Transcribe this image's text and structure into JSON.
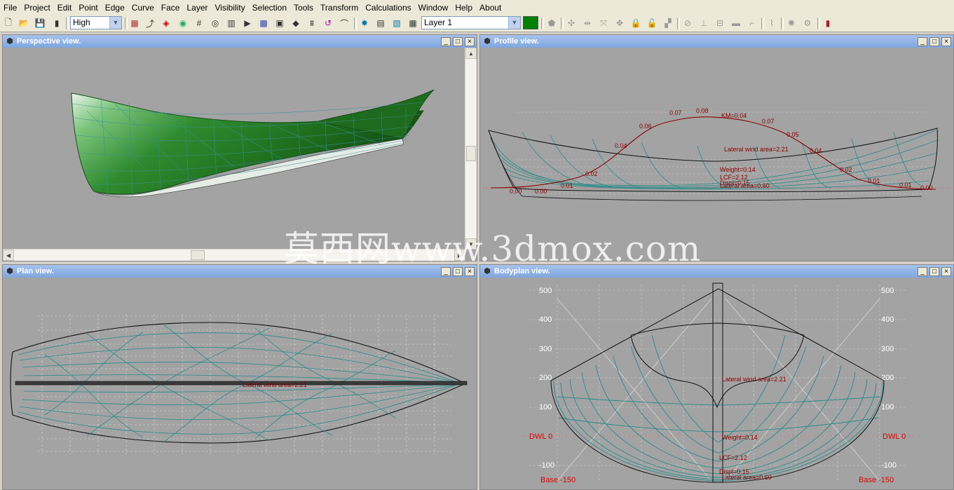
{
  "menu": [
    "File",
    "Project",
    "Edit",
    "Point",
    "Edge",
    "Curve",
    "Face",
    "Layer",
    "Visibility",
    "Selection",
    "Tools",
    "Transform",
    "Calculations",
    "Window",
    "Help",
    "About"
  ],
  "toolbar": {
    "precision_value": "High",
    "layer_value": "Layer 1",
    "layer_color": "#008000"
  },
  "windows": {
    "perspective": {
      "title": "Perspective view."
    },
    "profile": {
      "title": "Profile view."
    },
    "plan": {
      "title": "Plan view."
    },
    "bodyplan": {
      "title": "Bodyplan view."
    }
  },
  "profile_labels": {
    "stations": [
      "0.00",
      "0.00",
      "0.01",
      "0.02",
      "0.04",
      "0.06",
      "0.07",
      "0.08",
      "KM=0.04",
      "0.07",
      "0.05",
      "0.04",
      "0.02",
      "0.01",
      "0.01",
      "0.00"
    ],
    "lateral_wind_area": "Lateral wind area=2.21",
    "weight": "Weight=0.14",
    "lcf": "LCF=2.12",
    "displ": "Displ=0.15",
    "lateral_area": "Lateral area=0.60"
  },
  "plan_labels": {
    "center": "Lateral wind area=2.21"
  },
  "bodyplan": {
    "y_ticks": [
      "500",
      "400",
      "300",
      "200",
      "100",
      "-100"
    ],
    "dwl_left": "DWL 0",
    "dwl_right": "DWL 0",
    "base_left": "Base -150",
    "base_right": "Base -150",
    "lateral_wind_area": "Lateral wind area=2.21",
    "weight": "Weight=0.14",
    "lcf": "LCF=2.12",
    "displ": "Displ=0.15",
    "lateral_area": "Lateral area=0.60"
  },
  "colors": {
    "hull_green": "#2e8b2e",
    "station_teal": "#2a8a8a",
    "curve_red": "#8b0000",
    "view_bg": "#a3a3a3",
    "title_blue": "#7fa6de"
  },
  "watermark": "莫西网www.3dmox.com"
}
